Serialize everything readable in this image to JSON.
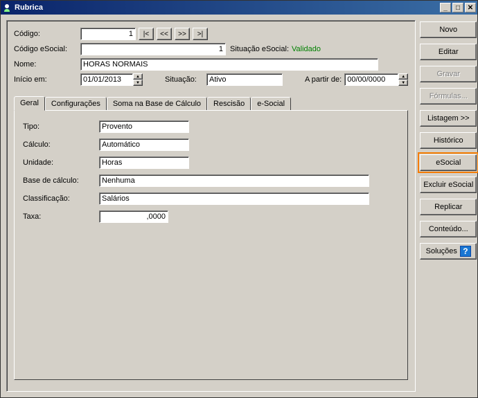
{
  "window": {
    "title": "Rubrica"
  },
  "header": {
    "labels": {
      "codigo": "Código:",
      "codigo_esocial": "Código eSocial:",
      "situacao_esocial": "Situação eSocial:",
      "nome": "Nome:",
      "inicio_em": "Início em:",
      "situacao": "Situação:",
      "a_partir_de": "A partir de:"
    },
    "values": {
      "codigo": "1",
      "codigo_esocial": "1",
      "situacao_esocial": "Validado",
      "nome": "HORAS NORMAIS",
      "inicio_em": "01/01/2013",
      "situacao": "Ativo",
      "a_partir_de": "00/00/0000"
    },
    "nav": {
      "first": "|<",
      "prev": "<<",
      "next": ">>",
      "last": ">|"
    }
  },
  "tabs": [
    {
      "label": "Geral"
    },
    {
      "label": "Configurações"
    },
    {
      "label": "Soma na Base de Cálculo"
    },
    {
      "label": "Rescisão"
    },
    {
      "label": "e-Social"
    }
  ],
  "geral": {
    "labels": {
      "tipo": "Tipo:",
      "calculo": "Cálculo:",
      "unidade": "Unidade:",
      "base": "Base de cálculo:",
      "classificacao": "Classificação:",
      "taxa": "Taxa:"
    },
    "values": {
      "tipo": "Provento",
      "calculo": "Automático",
      "unidade": "Horas",
      "base": "Nenhuma",
      "classificacao": "Salários",
      "taxa": ",0000"
    }
  },
  "actions": {
    "novo": "Novo",
    "editar": "Editar",
    "gravar": "Gravar",
    "formulas": "Fórmulas...",
    "listagem": "Listagem >>",
    "historico": "Histórico",
    "esocial": "eSocial",
    "excluir_esocial": "Excluir eSocial",
    "replicar": "Replicar",
    "conteudo": "Conteúdo...",
    "solucoes": "Soluções"
  }
}
